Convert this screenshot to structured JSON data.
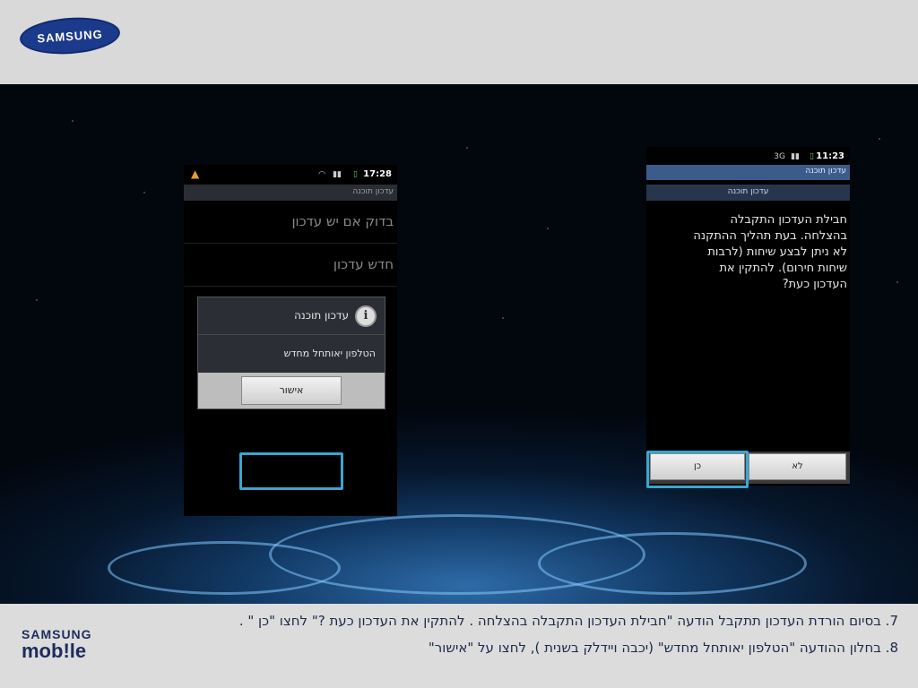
{
  "header": {
    "logo_text": "SAMSUNG"
  },
  "phone_left": {
    "status_time": "17:28",
    "app_title": "עדכון תוכנה",
    "menu_items": [
      "בדוק אם יש עדכון",
      "חדש עדכון"
    ],
    "dialog": {
      "title": "עדכון תוכנה",
      "message": "הטלפון יאותחל מחדש",
      "ok_label": "אישור"
    }
  },
  "phone_right": {
    "status_time": "11:23",
    "app_title": "עדכון תוכנה",
    "sub_title": "עדכון תוכנה",
    "message_lines": [
      "חבילת העדכון התקבלה",
      "בהצלחה. בעת תהליך ההתקנה",
      "לא ניתן לבצע שיחות (לרבות",
      "שיחות חירום). להתקין את",
      "העדכון כעת?"
    ],
    "yes_label": "כן",
    "no_label": "לא"
  },
  "footer": {
    "brand_line1": "SAMSUNG",
    "brand_line2": "mob!le",
    "instruction_1": "7. בסיום הורדת העדכון  תתקבל הודעה \"חבילת העדכון התקבלה בהצלחה . להתקין את העדכון כעת ?\" לחצו \"כן \" .",
    "instruction_2": "8. בחלון  ההודעה \"הטלפון יאותחל מחדש\" (יכבה ויידלק בשנית ), לחצו על \"אישור\""
  },
  "colors": {
    "highlight": "#3aa6d1",
    "brand_blue": "#1c3a8c",
    "title_bar_blue": "#3b5b8a"
  },
  "icons": [
    "wifi-icon",
    "signal-icon",
    "battery-icon",
    "info-icon",
    "app-icon"
  ]
}
